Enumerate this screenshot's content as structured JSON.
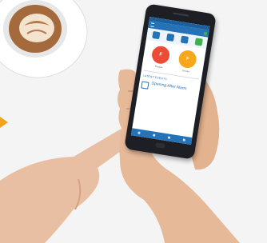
{
  "photo": {
    "description_objects": [
      "coffee-cup",
      "left-hand",
      "right-hand",
      "smartphone"
    ]
  },
  "phone": {
    "status_text": "",
    "app_title": "",
    "status_badge": "",
    "circles": [
      {
        "symbol": "F",
        "label": "Burglar",
        "color": "#ec4b35"
      },
      {
        "symbol": "F",
        "label": "Smoke",
        "color": "#f6a81a"
      }
    ],
    "section_title": "LATEST EVENTS",
    "event": {
      "title": "Opening After Alarm",
      "subtitle": ""
    },
    "see_more": ""
  },
  "colors": {
    "accent": "#2472b8",
    "arrow": "#f2a21b"
  }
}
